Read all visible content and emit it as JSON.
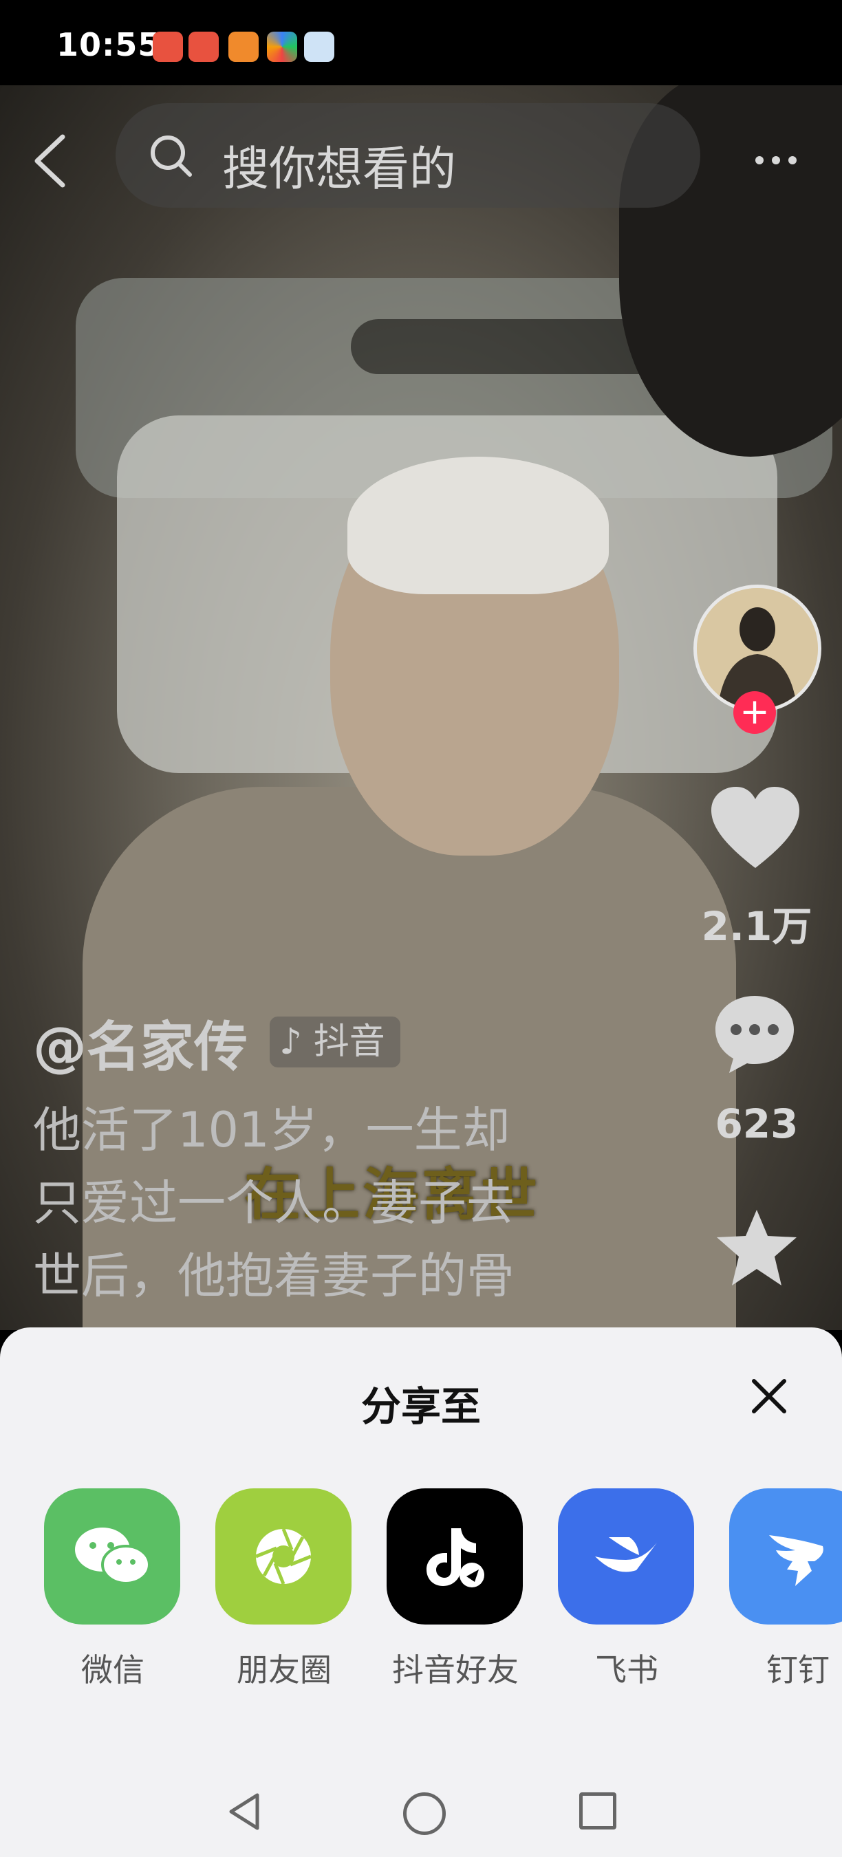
{
  "status_bar": {
    "time": "10:55"
  },
  "search": {
    "placeholder": "搜你想看的"
  },
  "video": {
    "overlay_title": "在上海离世",
    "author": "@名家传",
    "platform_tag": "抖音",
    "description_lines": [
      "他活了101岁，一生却",
      "只爱过一个人。妻子去",
      "世后，他抱着妻子的骨"
    ],
    "like_count": "2.1万",
    "comment_count": "623"
  },
  "share_sheet": {
    "title": "分享至",
    "targets": [
      {
        "label": "微信",
        "icon": "wechat-icon",
        "color": "#5bbf64"
      },
      {
        "label": "朋友圈",
        "icon": "moments-icon",
        "color": "#9fcf3f"
      },
      {
        "label": "抖音好友",
        "icon": "douyin-friend-icon",
        "color": "#000000"
      },
      {
        "label": "飞书",
        "icon": "feishu-icon",
        "color": "#3c6fea"
      },
      {
        "label": "钉钉",
        "icon": "dingtalk-icon",
        "color": "#4a90f2"
      }
    ]
  },
  "colors": {
    "follow_accent": "#ff2c55",
    "sheet_bg": "#f2f2f4"
  }
}
